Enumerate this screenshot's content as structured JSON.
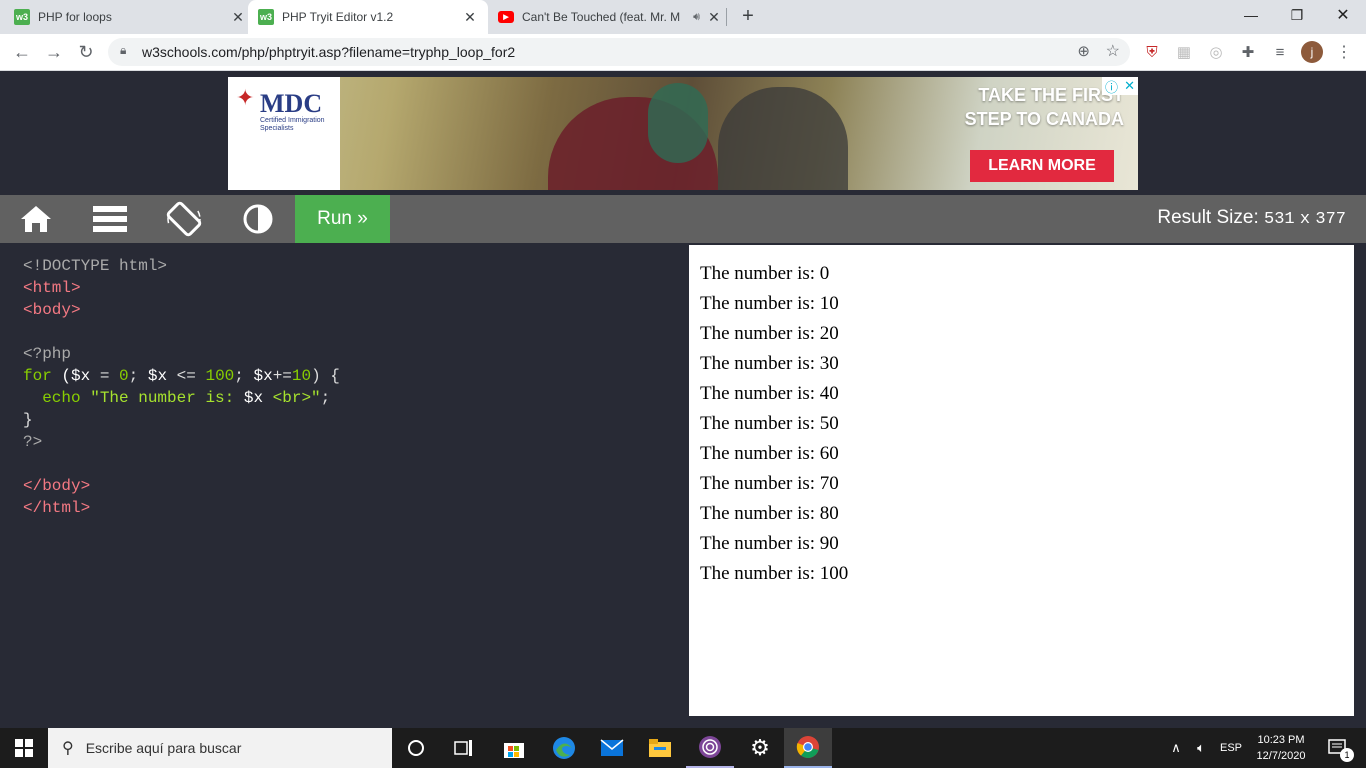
{
  "browser": {
    "tabs": [
      {
        "title": "PHP for loops",
        "favicon": "w3"
      },
      {
        "title": "PHP Tryit Editor v1.2",
        "favicon": "w3"
      },
      {
        "title": "Can't Be Touched (feat. Mr. M",
        "favicon": "youtube"
      }
    ],
    "new_tab": "+",
    "url": "w3schools.com/php/phptryit.asp?filename=tryphp_loop_for2",
    "profile_initial": "j"
  },
  "ad": {
    "brand": "MDC",
    "brand_sub": "Certified Immigration Specialists",
    "headline_1": "TAKE THE FIRST",
    "headline_2": "STEP TO CANADA",
    "cta": "LEARN MORE"
  },
  "editor": {
    "run_label": "Run »",
    "result_size_label": "Result Size:",
    "result_width": "531",
    "result_x": "x",
    "result_height": "377"
  },
  "result_lines": [
    "The number is: 0",
    "The number is: 10",
    "The number is: 20",
    "The number is: 30",
    "The number is: 40",
    "The number is: 50",
    "The number is: 60",
    "The number is: 70",
    "The number is: 80",
    "The number is: 90",
    "The number is: 100"
  ],
  "taskbar": {
    "search_placeholder": "Escribe aquí para buscar",
    "language": "ESP",
    "time": "10:23 PM",
    "date": "12/7/2020",
    "notification_count": "1"
  },
  "colors": {
    "w3_green": "#4caf50",
    "editor_bg": "#282a35",
    "toolbar_gray": "#616161",
    "ad_red": "#e2293f"
  }
}
